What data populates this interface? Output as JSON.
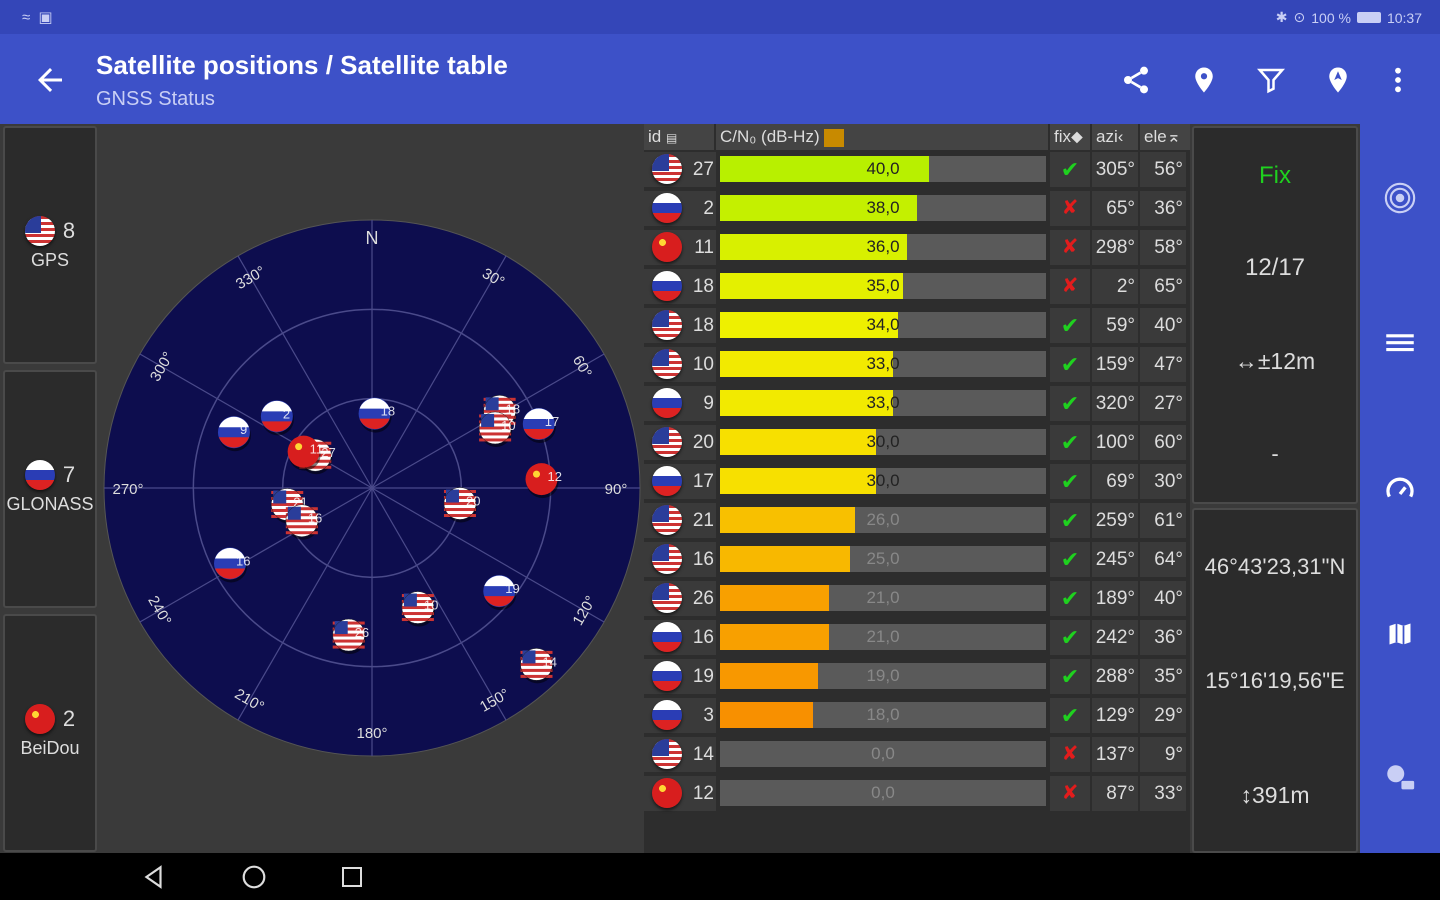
{
  "status_bar": {
    "left_icons": "≈ ▣",
    "battery": "100 %",
    "time": "10:37"
  },
  "appbar": {
    "title": "Satellite positions / Satellite table",
    "subtitle": "GNSS Status",
    "actions": [
      "share-icon",
      "location-pin-icon",
      "filter-icon",
      "nav-pin-icon",
      "more-vert-icon"
    ]
  },
  "constellations": [
    {
      "flag": "us",
      "count": "8",
      "name": "GPS"
    },
    {
      "flag": "ru",
      "count": "7",
      "name": "GLONASS"
    },
    {
      "flag": "cn",
      "count": "2",
      "name": "BeiDou"
    }
  ],
  "skyplot": {
    "north": "N",
    "azimuth_labels": [
      "30°",
      "60°",
      "90°",
      "120°",
      "150°",
      "180°",
      "210°",
      "240°",
      "270°",
      "300°",
      "330°"
    ],
    "satellites": [
      {
        "flag": "ru",
        "id": "2",
        "azimuth": 307,
        "elevation": 50
      },
      {
        "flag": "ru",
        "id": "9",
        "azimuth": 292,
        "elevation": 40
      },
      {
        "flag": "us",
        "id": "27",
        "azimuth": 300,
        "elevation": 68
      },
      {
        "flag": "cn",
        "id": "11",
        "azimuth": 298,
        "elevation": 64
      },
      {
        "flag": "ru",
        "id": "18",
        "azimuth": 2,
        "elevation": 65
      },
      {
        "flag": "us",
        "id": "18",
        "azimuth": 59,
        "elevation": 40
      },
      {
        "flag": "us",
        "id": "10",
        "azimuth": 64,
        "elevation": 44
      },
      {
        "flag": "ru",
        "id": "17",
        "azimuth": 69,
        "elevation": 30
      },
      {
        "flag": "cn",
        "id": "12",
        "azimuth": 87,
        "elevation": 33
      },
      {
        "flag": "us",
        "id": "21",
        "azimuth": 259,
        "elevation": 61
      },
      {
        "flag": "us",
        "id": "16",
        "azimuth": 245,
        "elevation": 64
      },
      {
        "flag": "us",
        "id": "20",
        "azimuth": 100,
        "elevation": 60
      },
      {
        "flag": "ru",
        "id": "16",
        "azimuth": 242,
        "elevation": 36
      },
      {
        "flag": "us",
        "id": "10",
        "azimuth": 159,
        "elevation": 47
      },
      {
        "flag": "ru",
        "id": "19",
        "azimuth": 129,
        "elevation": 35
      },
      {
        "flag": "us",
        "id": "14",
        "azimuth": 137,
        "elevation": 9
      },
      {
        "flag": "us",
        "id": "26",
        "azimuth": 189,
        "elevation": 40
      }
    ]
  },
  "table": {
    "headers": {
      "id": "id",
      "cn0": "C/N₀ (dB-Hz)",
      "fix": "fix",
      "azi": "azi",
      "ele": "ele"
    },
    "rows": [
      {
        "flag": "us",
        "id": "27",
        "cn0": "40,0",
        "fill": 0.64,
        "color": "#b8f000",
        "fix": true,
        "azi": "305°",
        "ele": "56°"
      },
      {
        "flag": "ru",
        "id": "2",
        "cn0": "38,0",
        "fill": 0.605,
        "color": "#c4f000",
        "fix": false,
        "azi": "65°",
        "ele": "36°"
      },
      {
        "flag": "cn",
        "id": "11",
        "cn0": "36,0",
        "fill": 0.575,
        "color": "#d8f000",
        "fix": false,
        "azi": "298°",
        "ele": "58°"
      },
      {
        "flag": "ru",
        "id": "18",
        "cn0": "35,0",
        "fill": 0.56,
        "color": "#e4f000",
        "fix": false,
        "azi": "2°",
        "ele": "65°"
      },
      {
        "flag": "us",
        "id": "18",
        "cn0": "34,0",
        "fill": 0.545,
        "color": "#eef000",
        "fix": true,
        "azi": "59°",
        "ele": "40°"
      },
      {
        "flag": "us",
        "id": "10",
        "cn0": "33,0",
        "fill": 0.53,
        "color": "#f2ea00",
        "fix": true,
        "azi": "159°",
        "ele": "47°"
      },
      {
        "flag": "ru",
        "id": "9",
        "cn0": "33,0",
        "fill": 0.53,
        "color": "#f2ea00",
        "fix": true,
        "azi": "320°",
        "ele": "27°"
      },
      {
        "flag": "us",
        "id": "20",
        "cn0": "30,0",
        "fill": 0.48,
        "color": "#f7e000",
        "fix": true,
        "azi": "100°",
        "ele": "60°"
      },
      {
        "flag": "ru",
        "id": "17",
        "cn0": "30,0",
        "fill": 0.48,
        "color": "#f7e000",
        "fix": true,
        "azi": "69°",
        "ele": "30°"
      },
      {
        "flag": "us",
        "id": "21",
        "cn0": "26,0",
        "fill": 0.415,
        "color": "#f8c000",
        "fix": true,
        "azi": "259°",
        "ele": "61°"
      },
      {
        "flag": "us",
        "id": "16",
        "cn0": "25,0",
        "fill": 0.4,
        "color": "#f8b800",
        "fix": true,
        "azi": "245°",
        "ele": "64°"
      },
      {
        "flag": "us",
        "id": "26",
        "cn0": "21,0",
        "fill": 0.335,
        "color": "#f8a000",
        "fix": true,
        "azi": "189°",
        "ele": "40°"
      },
      {
        "flag": "ru",
        "id": "16",
        "cn0": "21,0",
        "fill": 0.335,
        "color": "#f8a000",
        "fix": true,
        "azi": "242°",
        "ele": "36°"
      },
      {
        "flag": "ru",
        "id": "19",
        "cn0": "19,0",
        "fill": 0.3,
        "color": "#f89800",
        "fix": true,
        "azi": "288°",
        "ele": "35°"
      },
      {
        "flag": "ru",
        "id": "3",
        "cn0": "18,0",
        "fill": 0.285,
        "color": "#f89000",
        "fix": true,
        "azi": "129°",
        "ele": "29°"
      },
      {
        "flag": "us",
        "id": "14",
        "cn0": "0,0",
        "fill": 0.0,
        "color": "#f89000",
        "fix": false,
        "azi": "137°",
        "ele": "9°"
      },
      {
        "flag": "cn",
        "id": "12",
        "cn0": "0,0",
        "fill": 0.0,
        "color": "#f89000",
        "fix": false,
        "azi": "87°",
        "ele": "33°"
      }
    ]
  },
  "fix_panel": {
    "fix_label": "Fix",
    "sats_used": "12/17",
    "accuracy": "↔±12m",
    "extra": "-"
  },
  "position_panel": {
    "latitude": "46°43'23,31\"N",
    "longitude": "15°16'19,56\"E",
    "altitude": "↕391m"
  },
  "colors": {
    "primary": "#3d51c8",
    "status_bar": "#3446b8",
    "sky_background": "#0d0d4e",
    "fix_green": "#1fd11f",
    "no_fix_red": "#e21c1c"
  }
}
